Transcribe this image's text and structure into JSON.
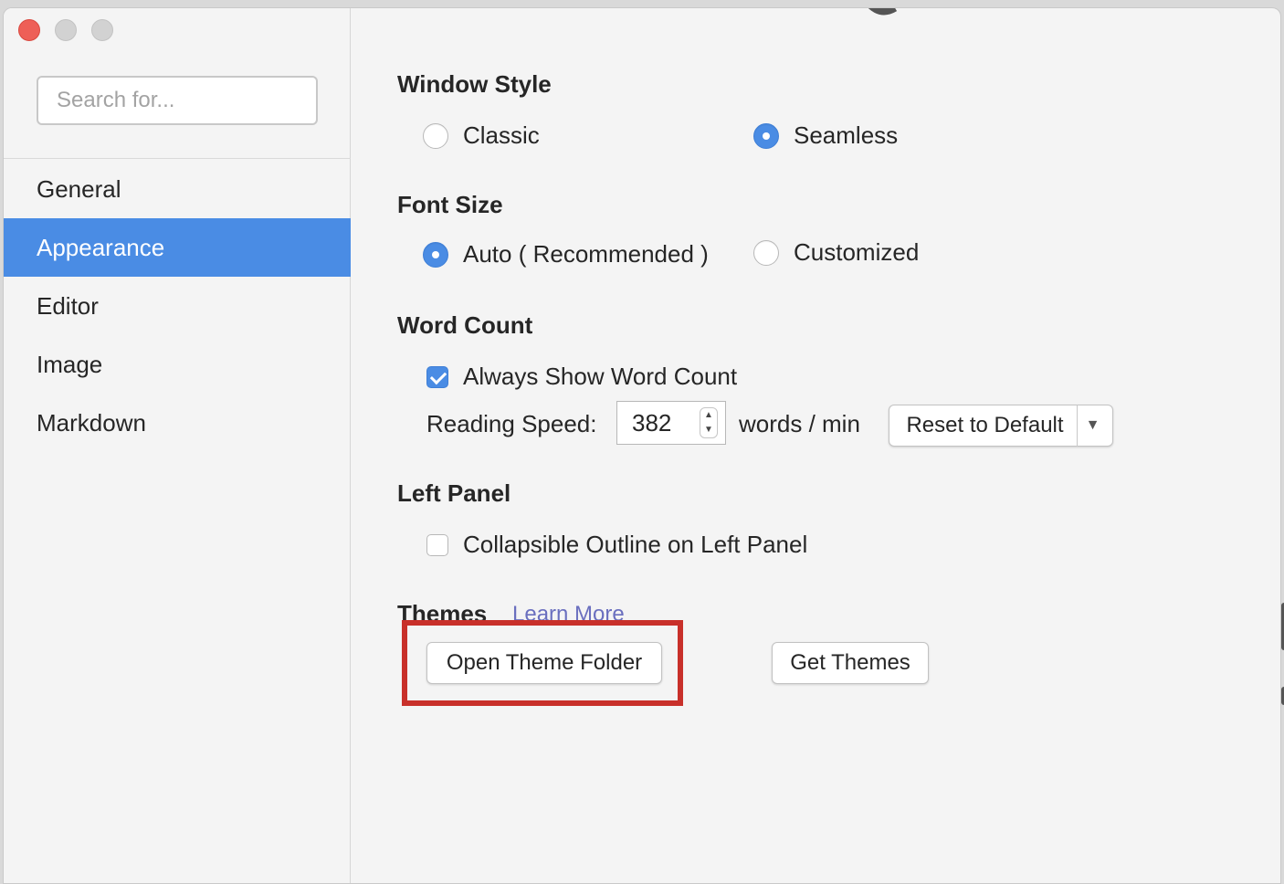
{
  "search": {
    "placeholder": "Search for..."
  },
  "sidebar": {
    "items": [
      {
        "label": "General"
      },
      {
        "label": "Appearance",
        "active": true
      },
      {
        "label": "Editor"
      },
      {
        "label": "Image"
      },
      {
        "label": "Markdown"
      }
    ]
  },
  "window_style": {
    "title": "Window Style",
    "options": [
      {
        "label": "Classic",
        "selected": false
      },
      {
        "label": "Seamless",
        "selected": true
      }
    ]
  },
  "font_size": {
    "title": "Font Size",
    "options": [
      {
        "label": "Auto ( Recommended )",
        "selected": true
      },
      {
        "label": "Customized",
        "selected": false
      }
    ]
  },
  "word_count": {
    "title": "Word Count",
    "always_show_label": "Always Show Word Count",
    "always_show_checked": true,
    "reading_speed_label": "Reading Speed:",
    "reading_speed_value": "382",
    "unit_label": "words / min",
    "reset_label": "Reset to Default"
  },
  "left_panel": {
    "title": "Left Panel",
    "collapsible_label": "Collapsible Outline on Left Panel",
    "collapsible_checked": false
  },
  "themes": {
    "title": "Themes",
    "learn_more": "Learn More",
    "open_folder_label": "Open Theme Folder",
    "get_themes_label": "Get Themes"
  },
  "colors": {
    "accent": "#4a8ce4",
    "highlight_box": "#c8302a",
    "link": "#6a6fbf"
  }
}
